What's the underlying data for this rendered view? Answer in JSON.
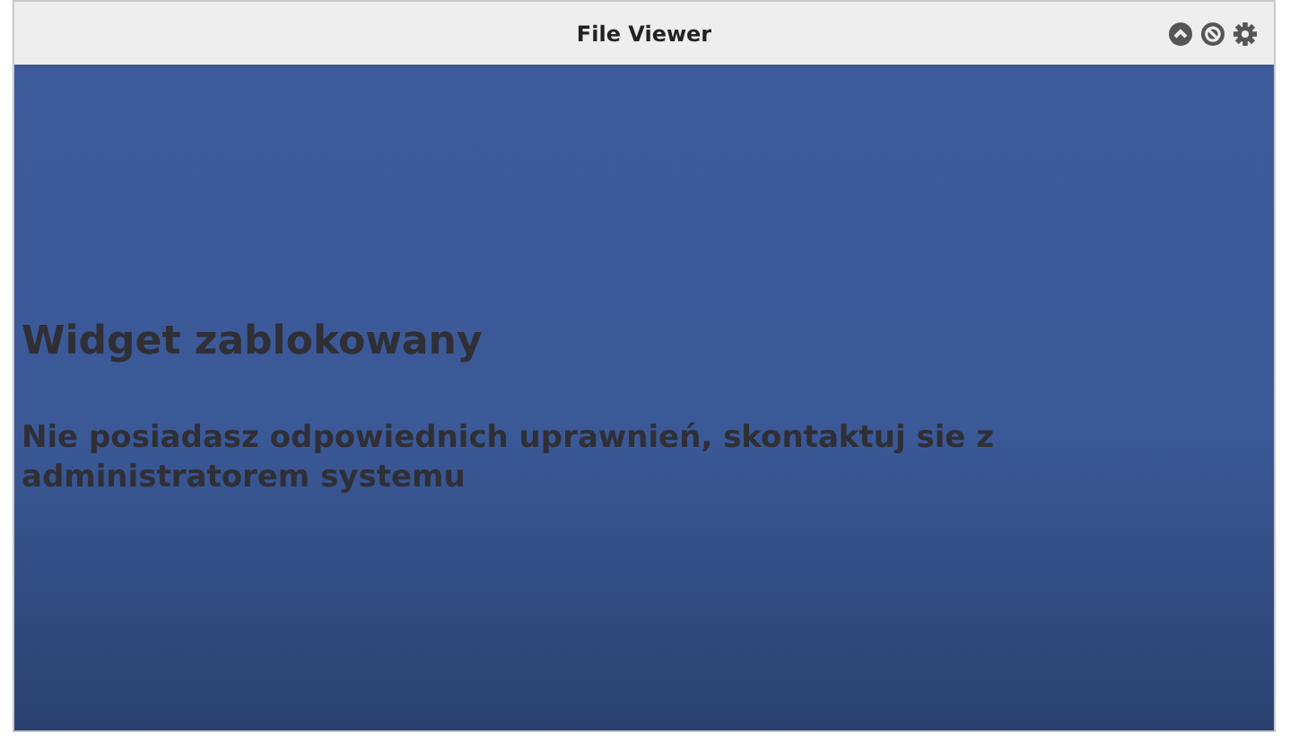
{
  "window": {
    "title": "File Viewer"
  },
  "header_icons": [
    {
      "kind": "collapse"
    },
    {
      "kind": "block"
    },
    {
      "kind": "settings"
    }
  ],
  "message": {
    "heading": "Widget zablokowany",
    "text": "Nie posiadasz odpowiednich uprawnień, skontaktuj sie z administratorem systemu"
  }
}
